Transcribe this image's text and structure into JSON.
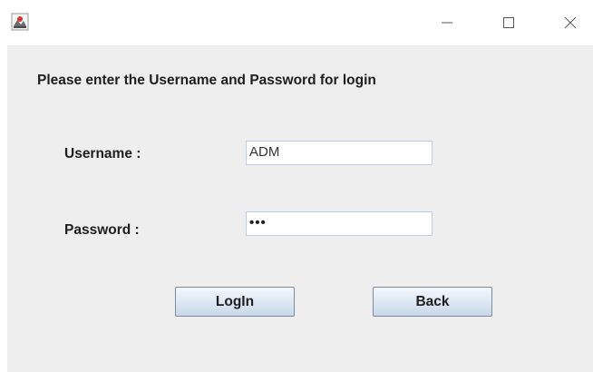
{
  "window": {
    "minimize_glyph": "—",
    "icon": "java-app-icon"
  },
  "form": {
    "prompt": "Please enter the Username and Password for login",
    "username_label": "Username :",
    "username_value": "ADM",
    "password_label": "Password :",
    "password_value": "•••"
  },
  "buttons": {
    "login": "LogIn",
    "back": "Back"
  },
  "colors": {
    "panel_background": "#eeeeee",
    "field_border": "#b8cfe5",
    "button_border": "#7a8a99"
  }
}
